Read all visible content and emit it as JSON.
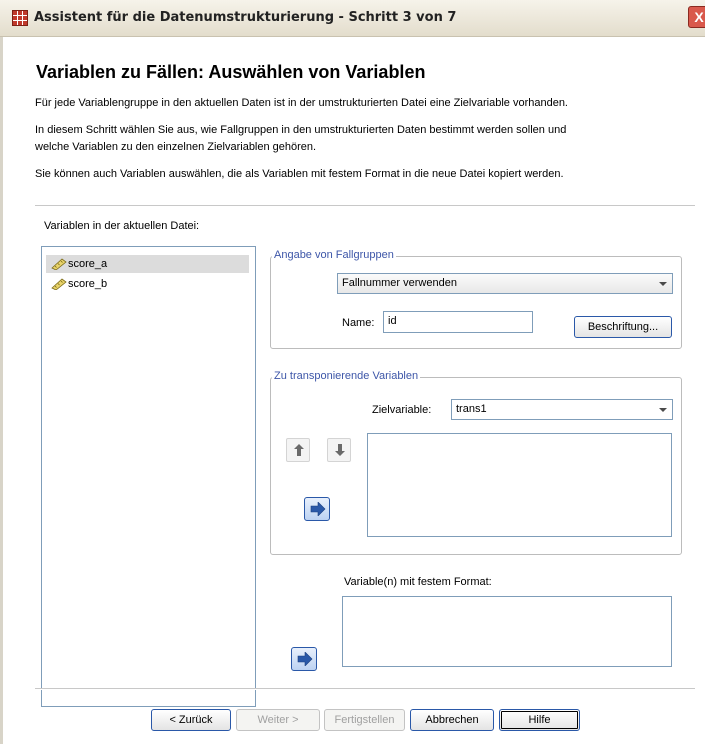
{
  "window": {
    "title": "Assistent für die Datenumstrukturierung - Schritt 3 von 7",
    "close_glyph": "X"
  },
  "page": {
    "heading": "Variablen zu Fällen: Auswählen von Variablen",
    "desc1": "Für jede Variablengruppe in den aktuellen Daten ist in der umstrukturierten Datei eine Zielvariable vorhanden.",
    "desc2_line1": "In diesem Schritt wählen Sie aus, wie Fallgruppen in den umstrukturierten Daten bestimmt werden sollen und",
    "desc2_line2": "welche Variablen zu den einzelnen Zielvariablen gehören.",
    "desc3": "Sie können auch Variablen auswählen, die als Variablen mit festem Format in die neue Datei kopiert werden."
  },
  "source": {
    "label": "Variablen in der aktuellen Datei:",
    "items": [
      "score_a",
      "score_b"
    ],
    "icon": "ruler-icon"
  },
  "case_group": {
    "legend": "Angabe von Fallgruppen",
    "method_value": "Fallnummer verwenden",
    "name_label": "Name:",
    "name_value": "id",
    "label_button": "Beschriftung..."
  },
  "transpose": {
    "legend": "Zu transponierende Variablen",
    "target_label": "Zielvariable:",
    "target_value": "trans1"
  },
  "fixed": {
    "label": "Variable(n) mit festem Format:"
  },
  "footer": {
    "back": "< Zurück",
    "next": "Weiter >",
    "finish": "Fertigstellen",
    "cancel": "Abbrechen",
    "help": "Hilfe"
  },
  "colors": {
    "accent": "#2a58a8",
    "legend_text": "#3d56a8",
    "selection": "#dcdcdc"
  }
}
